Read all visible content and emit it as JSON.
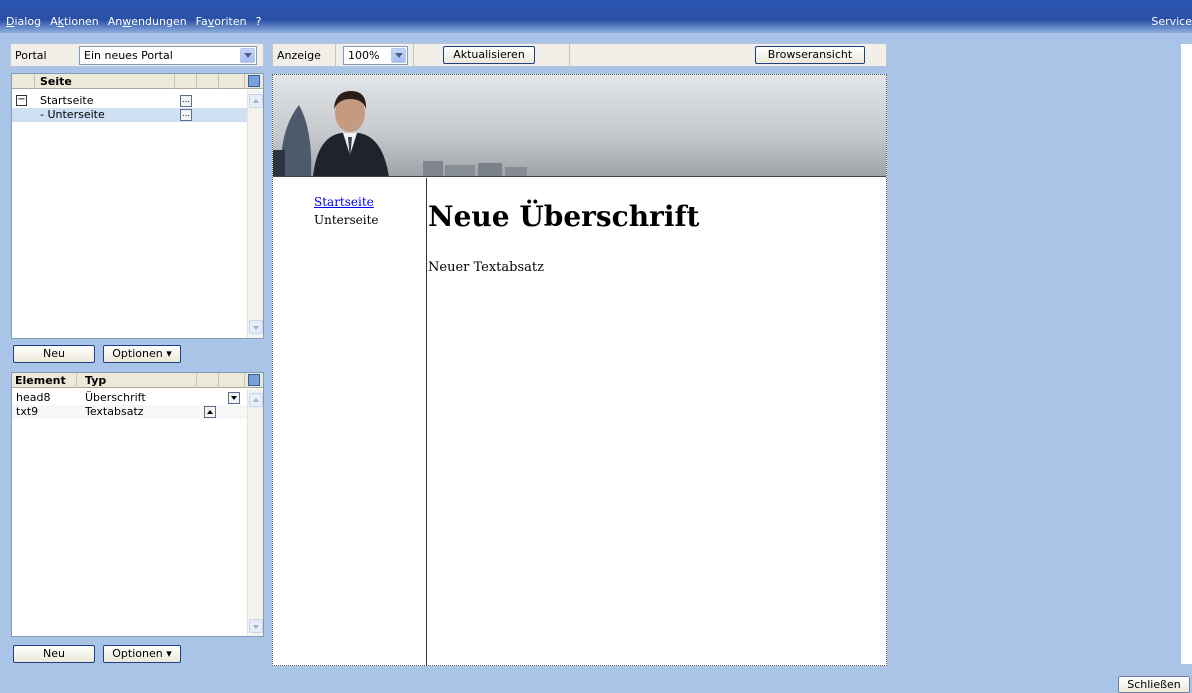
{
  "menu": {
    "items": [
      {
        "pre": "",
        "ul": "D",
        "post": "ialog"
      },
      {
        "pre": "A",
        "ul": "k",
        "post": "tionen"
      },
      {
        "pre": "An",
        "ul": "w",
        "post": "endungen"
      },
      {
        "pre": "Fa",
        "ul": "v",
        "post": "oriten"
      },
      {
        "pre": "",
        "ul": "",
        "post": "?"
      }
    ],
    "service": "Service"
  },
  "portal": {
    "label": "Portal",
    "selected": "Ein neues Portal"
  },
  "pages": {
    "header": "Seite",
    "rows": [
      {
        "label": "Startseite",
        "expanded": true
      },
      {
        "label": "- Unterseite",
        "selected": true
      }
    ],
    "new_button": "Neu",
    "options_button": "Optionen"
  },
  "elements": {
    "col_element": "Element",
    "col_type": "Typ",
    "rows": [
      {
        "element": "head8",
        "type": "Überschrift"
      },
      {
        "element": "txt9",
        "type": "Textabsatz"
      }
    ],
    "new_button": "Neu",
    "options_button": "Optionen"
  },
  "view": {
    "label": "Anzeige",
    "zoom": "100%",
    "refresh_button": "Aktualisieren",
    "browser_button": "Browseransicht"
  },
  "preview": {
    "nav": [
      "Startseite",
      "Unterseite"
    ],
    "heading": "Neue Überschrift",
    "paragraph": "Neuer Textabsatz"
  },
  "footer": {
    "close_button": "Schließen"
  },
  "colors": {
    "background": "#a9c4e6",
    "menubar": "#2a50a6",
    "link": "#0000ee",
    "selected_row": "#cfe0f5"
  }
}
